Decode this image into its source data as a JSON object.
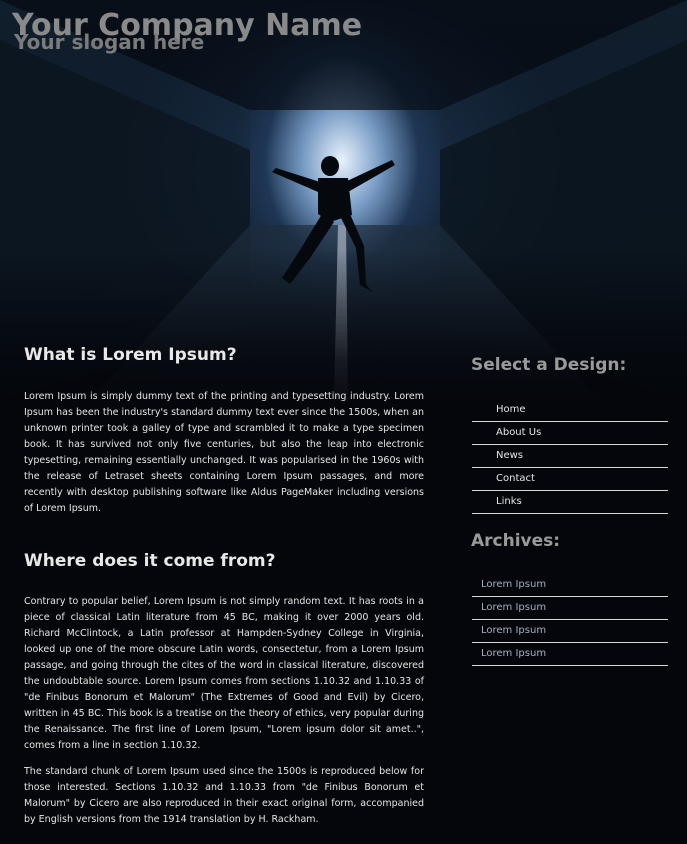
{
  "header": {
    "company_name": "Your Company Name",
    "slogan": "Your slogan here"
  },
  "main": {
    "sections": [
      {
        "heading": "What is Lorem Ipsum?",
        "paragraphs": [
          "Lorem Ipsum is simply dummy text of the printing and typesetting industry. Lorem Ipsum has been the industry's standard dummy text ever since the 1500s, when an unknown printer took a galley of type and scrambled it to make a type specimen book. It has survived not only five centuries, but also the leap into electronic typesetting, remaining essentially unchanged. It was popularised in the 1960s with the release of Letraset sheets containing Lorem Ipsum passages, and more recently with desktop publishing software like Aldus PageMaker including versions of Lorem Ipsum."
        ]
      },
      {
        "heading": "Where does it come from?",
        "paragraphs": [
          "Contrary to popular belief, Lorem Ipsum is not simply random text. It has roots in a piece of classical Latin literature from 45 BC, making it over 2000 years old. Richard McClintock, a Latin professor at Hampden-Sydney College in Virginia, looked up one of the more obscure Latin words, consectetur, from a Lorem Ipsum passage, and going through the cites of the word in classical literature, discovered the undoubtable source. Lorem Ipsum comes from sections 1.10.32 and 1.10.33 of \"de Finibus Bonorum et Malorum\" (The Extremes of Good and Evil) by Cicero, written in 45 BC. This book is a treatise on the theory of ethics, very popular during the Renaissance. The first line of Lorem Ipsum, \"Lorem ipsum dolor sit amet..\", comes from a line in section 1.10.32.",
          "The standard chunk of Lorem Ipsum used since the 1500s is reproduced below for those interested. Sections 1.10.32 and 1.10.33 from \"de Finibus Bonorum et Malorum\" by Cicero are also reproduced in their exact original form, accompanied by English versions from the 1914 translation by H. Rackham."
        ]
      }
    ]
  },
  "sidebar": {
    "design_title": "Select a Design:",
    "nav_items": [
      {
        "label": "Home"
      },
      {
        "label": "About Us"
      },
      {
        "label": "News"
      },
      {
        "label": "Contact"
      },
      {
        "label": "Links"
      }
    ],
    "archives_title": "Archives:",
    "archive_items": [
      {
        "label": "Lorem Ipsum"
      },
      {
        "label": "Lorem Ipsum"
      },
      {
        "label": "Lorem Ipsum"
      },
      {
        "label": "Lorem Ipsum"
      }
    ]
  }
}
